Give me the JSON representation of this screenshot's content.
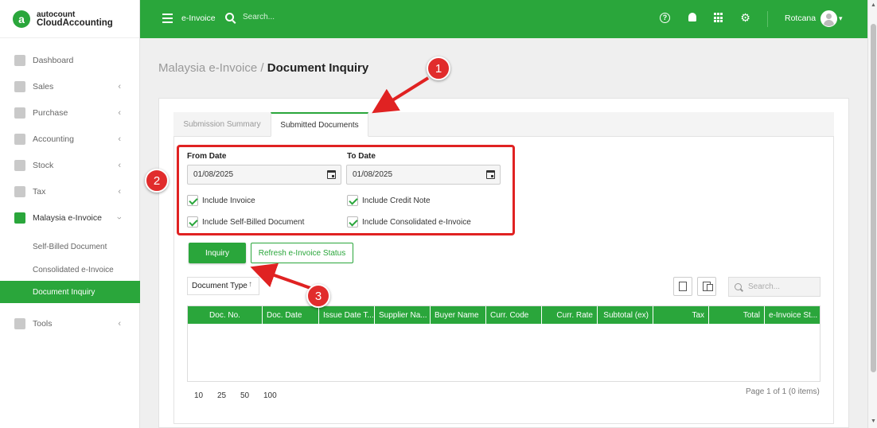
{
  "brand": {
    "line1": "autocount",
    "line2": "CloudAccounting",
    "logo_letter": "a"
  },
  "sidebar": {
    "items": [
      {
        "label": "Dashboard",
        "icon": "dashboard-icon",
        "has_chevron": false
      },
      {
        "label": "Sales",
        "icon": "sales-icon",
        "has_chevron": true
      },
      {
        "label": "Purchase",
        "icon": "purchase-icon",
        "has_chevron": true
      },
      {
        "label": "Accounting",
        "icon": "accounting-icon",
        "has_chevron": true
      },
      {
        "label": "Stock",
        "icon": "stock-icon",
        "has_chevron": true
      },
      {
        "label": "Tax",
        "icon": "tax-icon",
        "has_chevron": true
      },
      {
        "label": "Malaysia e-Invoice",
        "icon": "einvoice-icon",
        "has_chevron": true,
        "open": true
      },
      {
        "label": "Tools",
        "icon": "wrench-icon",
        "has_chevron": true
      }
    ],
    "subitems": [
      {
        "label": "Self-Billed Document",
        "active": false
      },
      {
        "label": "Consolidated e-Invoice",
        "active": false
      },
      {
        "label": "Document Inquiry",
        "active": true
      }
    ]
  },
  "topbar": {
    "title": "e-Invoice",
    "search_placeholder": "Search...",
    "user_name": "Rotcana",
    "help_glyph": "?"
  },
  "breadcrumb": {
    "parent": "Malaysia e-Invoice",
    "separator": "/",
    "current": "Document Inquiry"
  },
  "tabs": [
    {
      "label": "Submission Summary",
      "active": false
    },
    {
      "label": "Submitted Documents",
      "active": true
    }
  ],
  "filters": {
    "from_date_label": "From Date",
    "from_date_value": "01/08/2025",
    "to_date_label": "To Date",
    "to_date_value": "01/08/2025",
    "checkboxes": [
      {
        "label": "Include Invoice",
        "checked": true
      },
      {
        "label": "Include Credit Note",
        "checked": true
      },
      {
        "label": "Include Self-Billed Document",
        "checked": true
      },
      {
        "label": "Include Consolidated e-Invoice",
        "checked": true
      }
    ]
  },
  "actions": {
    "inquiry_label": "Inquiry",
    "refresh_label": "Refresh e-Invoice Status"
  },
  "grid": {
    "group_by_label": "Document Type",
    "sort_glyph": "↑",
    "search_placeholder": "Search...",
    "columns": [
      "Doc. No.",
      "Doc. Date",
      "Issue Date T...",
      "Supplier Na...",
      "Buyer Name",
      "Curr. Code",
      "Curr. Rate",
      "Subtotal (ex)",
      "Tax",
      "Total",
      "e-Invoice St..."
    ],
    "rows": [],
    "page_sizes": [
      "10",
      "25",
      "50",
      "100"
    ],
    "page_info": "Page 1 of 1 (0 items)"
  },
  "annotations": {
    "badge1": "1",
    "badge2": "2",
    "badge3": "3",
    "color": "#e02222"
  },
  "colors": {
    "accent": "#2aa63b",
    "annotation": "#e02222"
  }
}
